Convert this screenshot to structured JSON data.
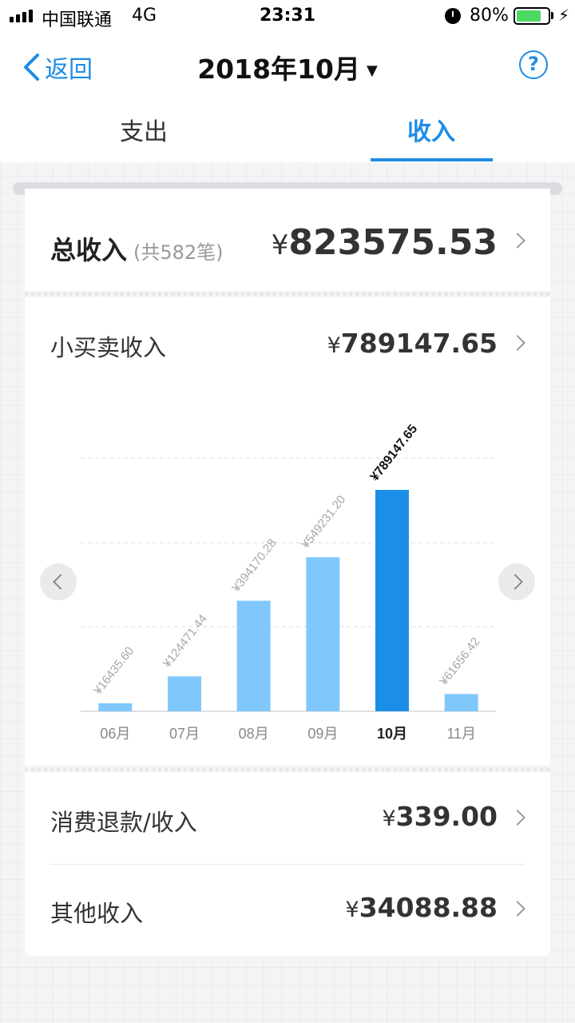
{
  "status_bar": {
    "carrier": "中国联通",
    "network": "4G",
    "time": "23:31",
    "battery": "80%",
    "battery_level": 0.8
  },
  "nav": {
    "back_label": "返回",
    "title": "2018年10月",
    "caret": "▼",
    "help_glyph": "?"
  },
  "tabs": {
    "expense": "支出",
    "income": "收入",
    "active": "income"
  },
  "total": {
    "label": "总收入",
    "count": "(共582笔)",
    "currency": "¥",
    "amount": "823575.53"
  },
  "shop": {
    "label": "小买卖收入",
    "currency": "¥",
    "amount": "789147.65"
  },
  "rows": [
    {
      "label": "消费退款/收入",
      "currency": "¥",
      "amount": "339.00"
    },
    {
      "label": "其他收入",
      "currency": "¥",
      "amount": "34088.88"
    }
  ],
  "colors": {
    "accent": "#1e8ce6",
    "bar": "#80c8fc",
    "bar_active": "#1b8fe8"
  },
  "chart_data": {
    "type": "bar",
    "categories": [
      "06月",
      "07月",
      "08月",
      "09月",
      "10月",
      "11月"
    ],
    "values": [
      16435.6,
      124471.44,
      394170.28,
      549231.2,
      789147.65,
      61656.42
    ],
    "labels": [
      "¥16435.60",
      "¥124471.44",
      "¥394170.28",
      "¥549231.20",
      "¥789147.65",
      "¥61656.42"
    ],
    "active_index": 4,
    "grid": true
  }
}
